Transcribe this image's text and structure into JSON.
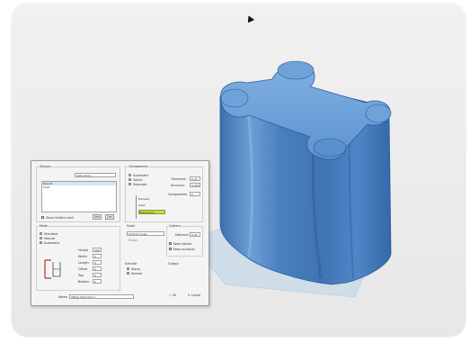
{
  "viewport": {
    "background": "#eeeeee",
    "part_color": "#4f85c4",
    "plate_color": "#c8dbe8"
  },
  "dialog": {
    "group_shapes": "Shapes",
    "shape_field": "Instruct/Cl:...",
    "list_items": [
      "Base B",
      "Shell"
    ],
    "show_hidden_label": "Show hidden shell",
    "btn_add": "Add",
    "btn_del": "Del",
    "group_components": "Components",
    "radio_automatic": "Automatic",
    "radio_select": "Select",
    "radio_separate": "Separate",
    "tree_items": [
      "Element",
      "Shell",
      "Base piece"
    ],
    "thickness_label": "Thickness",
    "thickness_value": "0.25",
    "accuracy_label": "Accuracy",
    "accuracy_value": "0.001",
    "comp_count_label": "Components",
    "comp_count_value": "2",
    "group_scale": "Scale",
    "scale_select": "Uniform scale",
    "scale_factor": "Factor",
    "group_mode": "Mode",
    "mode_items": [
      "Standard",
      "Manual",
      "Automatic"
    ],
    "size_rows": [
      {
        "label": "Height",
        "value": "100"
      },
      {
        "label": "Width",
        "value": "0"
      },
      {
        "label": "Length",
        "value": "0"
      },
      {
        "label": "Offset",
        "value": "0"
      },
      {
        "label": "Top",
        "value": "0"
      },
      {
        "label": "Bottom",
        "value": "0"
      }
    ],
    "group_options": "Options",
    "opt_distance_label": "Distance",
    "opt_distance_value": "0.00",
    "opt_checks": [
      "Keep blocks",
      "Keep surfaces"
    ],
    "group_extrude": "Extrude",
    "extrude_items": [
      "Along",
      "Normal"
    ],
    "group_output": "Output",
    "name_label": "Name",
    "name_value": "Offset Shell Part 1",
    "ok_label": "OK",
    "cancel_label": "Cancel",
    "ok_prefix": "✓",
    "cancel_prefix": "✕"
  }
}
